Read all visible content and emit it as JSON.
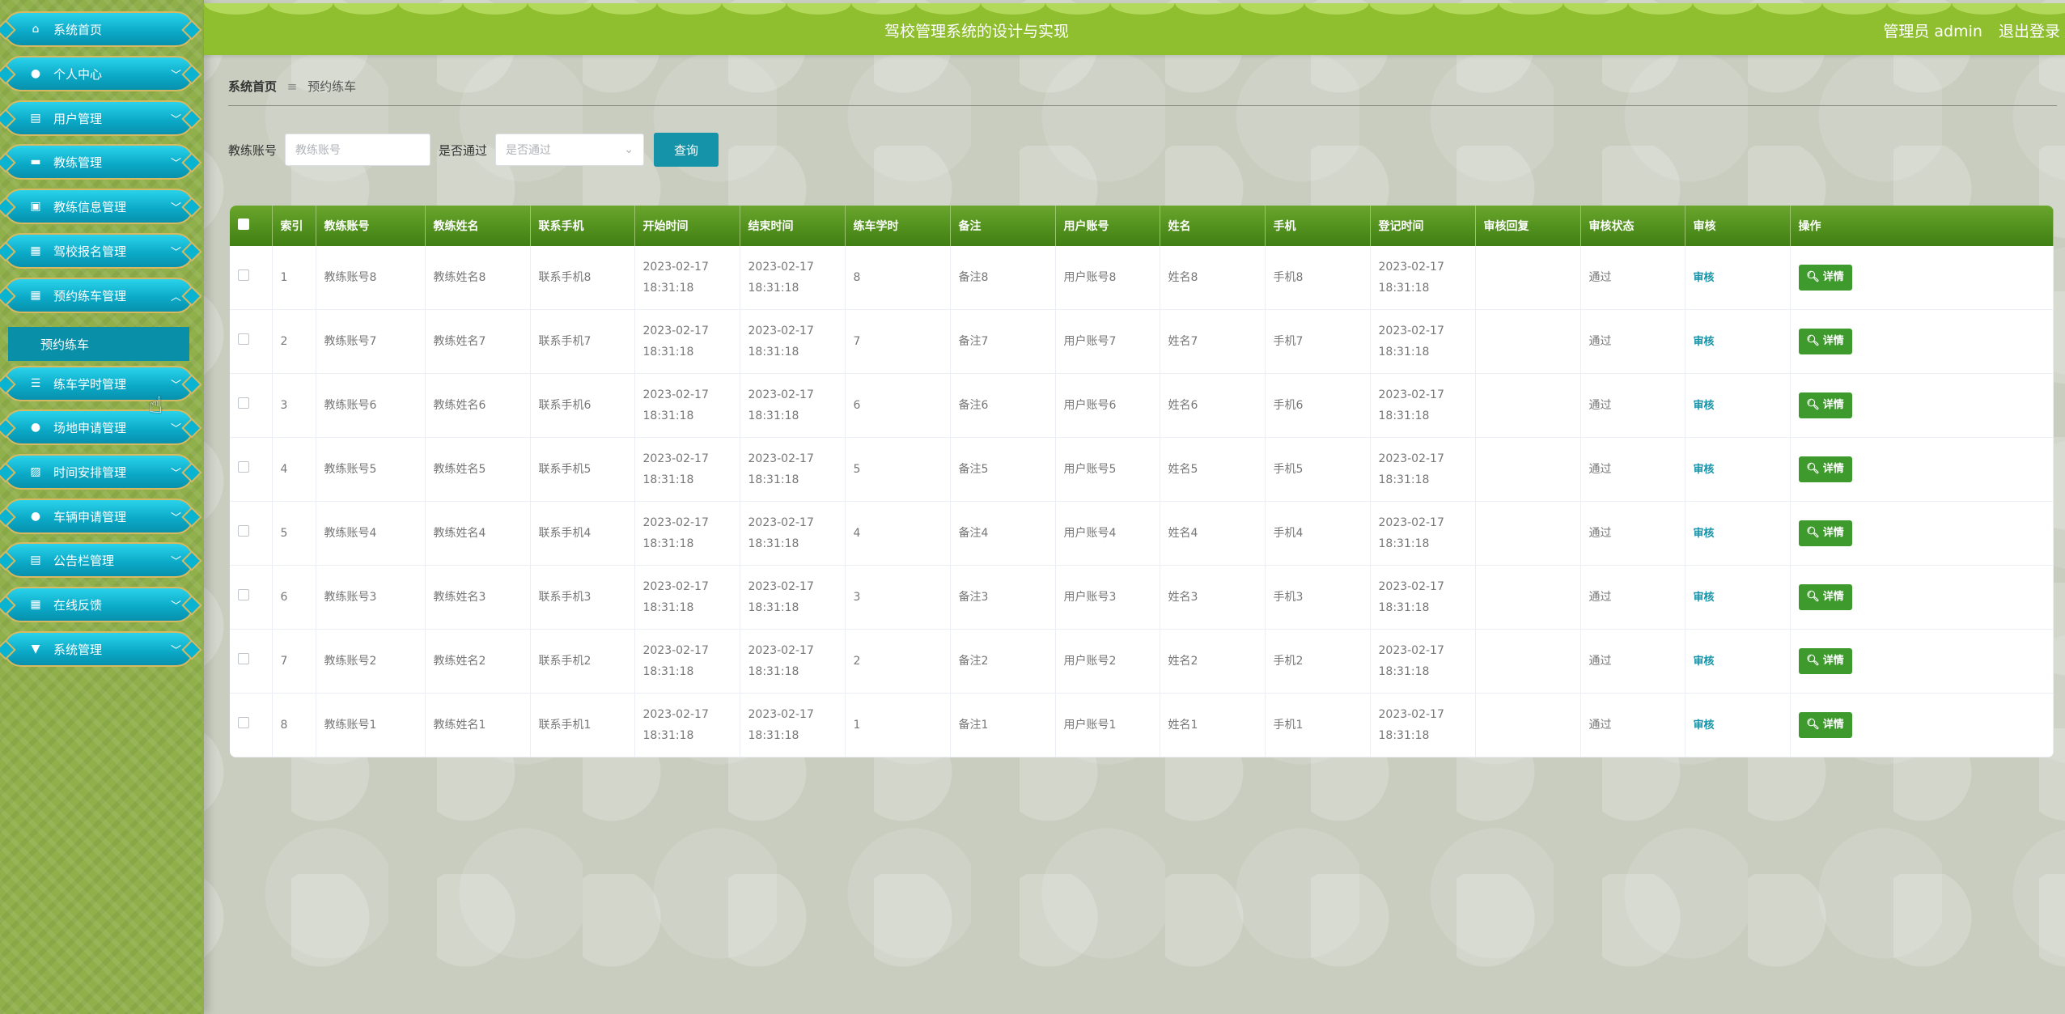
{
  "sidebar": {
    "items": [
      {
        "label": "系统首页",
        "icon": "home-icon",
        "glyph": "⌂"
      },
      {
        "label": "个人中心",
        "icon": "user-icon",
        "glyph": "●"
      },
      {
        "label": "用户管理",
        "icon": "document-icon",
        "glyph": "▤"
      },
      {
        "label": "教练管理",
        "icon": "comment-icon",
        "glyph": "▬"
      },
      {
        "label": "教练信息管理",
        "icon": "briefcase-icon",
        "glyph": "▣"
      },
      {
        "label": "驾校报名管理",
        "icon": "grid-icon",
        "glyph": "▦"
      },
      {
        "label": "预约练车管理",
        "icon": "grid-icon",
        "glyph": "▦"
      },
      {
        "label": "练车学时管理",
        "icon": "list-icon",
        "glyph": "☰"
      },
      {
        "label": "场地申请管理",
        "icon": "user-icon",
        "glyph": "●"
      },
      {
        "label": "时间安排管理",
        "icon": "calendar-icon",
        "glyph": "▨"
      },
      {
        "label": "车辆申请管理",
        "icon": "user-icon",
        "glyph": "●"
      },
      {
        "label": "公告栏管理",
        "icon": "clipboard-icon",
        "glyph": "▤"
      },
      {
        "label": "在线反馈",
        "icon": "grid-icon",
        "glyph": "▦"
      },
      {
        "label": "系统管理",
        "icon": "pin-icon",
        "glyph": "▼"
      }
    ],
    "submenu_label": "预约练车"
  },
  "header": {
    "title": "驾校管理系统的设计与实现",
    "role": "管理员 admin",
    "logout": "退出登录"
  },
  "breadcrumb": {
    "home": "系统首页",
    "sep": "≡",
    "current": "预约练车"
  },
  "search": {
    "coach_label": "教练账号",
    "coach_placeholder": "教练账号",
    "pass_label": "是否通过",
    "pass_placeholder": "是否通过",
    "query_label": "查询"
  },
  "table": {
    "headers": [
      "索引",
      "教练账号",
      "教练姓名",
      "联系手机",
      "开始时间",
      "结束时间",
      "练车学时",
      "备注",
      "用户账号",
      "姓名",
      "手机",
      "登记时间",
      "审核回复",
      "审核状态",
      "审核",
      "操作"
    ],
    "audit_label": "审核",
    "detail_label": "详情",
    "rows": [
      {
        "idx": "1",
        "coach": "教练账号8",
        "name": "教练姓名8",
        "phone": "联系手机8",
        "start": "2023-02-17 18:31:18",
        "end": "2023-02-17 18:31:18",
        "hours": "8",
        "note": "备注8",
        "user": "用户账号8",
        "uname": "姓名8",
        "mobile": "手机8",
        "reg": "2023-02-17 18:31:18",
        "reply": "",
        "status": "通过"
      },
      {
        "idx": "2",
        "coach": "教练账号7",
        "name": "教练姓名7",
        "phone": "联系手机7",
        "start": "2023-02-17 18:31:18",
        "end": "2023-02-17 18:31:18",
        "hours": "7",
        "note": "备注7",
        "user": "用户账号7",
        "uname": "姓名7",
        "mobile": "手机7",
        "reg": "2023-02-17 18:31:18",
        "reply": "",
        "status": "通过"
      },
      {
        "idx": "3",
        "coach": "教练账号6",
        "name": "教练姓名6",
        "phone": "联系手机6",
        "start": "2023-02-17 18:31:18",
        "end": "2023-02-17 18:31:18",
        "hours": "6",
        "note": "备注6",
        "user": "用户账号6",
        "uname": "姓名6",
        "mobile": "手机6",
        "reg": "2023-02-17 18:31:18",
        "reply": "",
        "status": "通过"
      },
      {
        "idx": "4",
        "coach": "教练账号5",
        "name": "教练姓名5",
        "phone": "联系手机5",
        "start": "2023-02-17 18:31:18",
        "end": "2023-02-17 18:31:18",
        "hours": "5",
        "note": "备注5",
        "user": "用户账号5",
        "uname": "姓名5",
        "mobile": "手机5",
        "reg": "2023-02-17 18:31:18",
        "reply": "",
        "status": "通过"
      },
      {
        "idx": "5",
        "coach": "教练账号4",
        "name": "教练姓名4",
        "phone": "联系手机4",
        "start": "2023-02-17 18:31:18",
        "end": "2023-02-17 18:31:18",
        "hours": "4",
        "note": "备注4",
        "user": "用户账号4",
        "uname": "姓名4",
        "mobile": "手机4",
        "reg": "2023-02-17 18:31:18",
        "reply": "",
        "status": "通过"
      },
      {
        "idx": "6",
        "coach": "教练账号3",
        "name": "教练姓名3",
        "phone": "联系手机3",
        "start": "2023-02-17 18:31:18",
        "end": "2023-02-17 18:31:18",
        "hours": "3",
        "note": "备注3",
        "user": "用户账号3",
        "uname": "姓名3",
        "mobile": "手机3",
        "reg": "2023-02-17 18:31:18",
        "reply": "",
        "status": "通过"
      },
      {
        "idx": "7",
        "coach": "教练账号2",
        "name": "教练姓名2",
        "phone": "联系手机2",
        "start": "2023-02-17 18:31:18",
        "end": "2023-02-17 18:31:18",
        "hours": "2",
        "note": "备注2",
        "user": "用户账号2",
        "uname": "姓名2",
        "mobile": "手机2",
        "reg": "2023-02-17 18:31:18",
        "reply": "",
        "status": "通过"
      },
      {
        "idx": "8",
        "coach": "教练账号1",
        "name": "教练姓名1",
        "phone": "联系手机1",
        "start": "2023-02-17 18:31:18",
        "end": "2023-02-17 18:31:18",
        "hours": "1",
        "note": "备注1",
        "user": "用户账号1",
        "uname": "姓名1",
        "mobile": "手机1",
        "reg": "2023-02-17 18:31:18",
        "reply": "",
        "status": "通过"
      }
    ]
  }
}
